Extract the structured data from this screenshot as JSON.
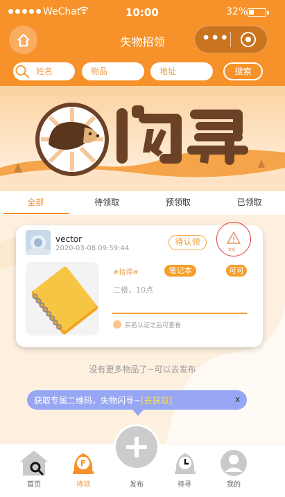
{
  "status_bar": {
    "carrier": "WeChat",
    "time": "10:00",
    "battery": "32%",
    "battery_level": 0.32
  },
  "nav": {
    "title": "失物招领",
    "more_icon": "•••"
  },
  "search": {
    "name_placeholder": "姓名",
    "item_placeholder": "物品",
    "address_placeholder": "地址",
    "button": "搜索"
  },
  "banner": {
    "brand": "闪寻"
  },
  "tabs": [
    "全部",
    "待领取",
    "预领取",
    "已领取"
  ],
  "card": {
    "username": "vector",
    "time": "2020-03-08 09:59:44",
    "confirm_button": "待认领",
    "report_label": "举报",
    "type_tag": "#拾得#",
    "category": "笔记本",
    "status": "可可",
    "description": "二楼，10点",
    "verify_text": "实名认证之后可查看"
  },
  "no_more_text": "没有更多物品了~可以去发布",
  "promo": {
    "text": "获取专属二维码，失物闪寻~",
    "link": "[去获取]",
    "close": "x"
  },
  "tabbar": [
    {
      "label": "首页",
      "icon": "home-search-icon"
    },
    {
      "label": "待领",
      "icon": "claim-badge-icon"
    },
    {
      "label": "发布",
      "icon": "plus-icon"
    },
    {
      "label": "待寻",
      "icon": "clock-bell-icon"
    },
    {
      "label": "我的",
      "icon": "user-avatar-icon"
    }
  ],
  "colors": {
    "brand": "#f7922b",
    "promo": "#98a7f3",
    "promo_link": "#ffe23a",
    "report_circle": "#e23a3a"
  }
}
